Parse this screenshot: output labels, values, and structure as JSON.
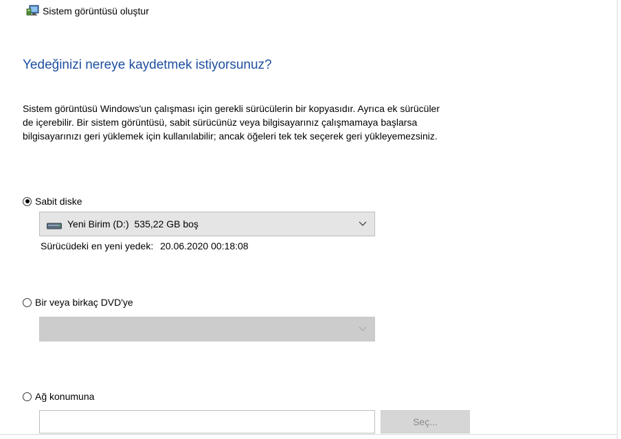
{
  "window": {
    "title": "Sistem görüntüsü oluştur"
  },
  "heading": "Yedeğinizi nereye kaydetmek istiyorsunuz?",
  "description": [
    "Sistem görüntüsü Windows'un çalışması için gerekli sürücülerin bir kopyasıdır. Ayrıca ek sürücüler",
    "de içerebilir. Bir sistem görüntüsü, sabit sürücünüz veya bilgisayarınız çalışmamaya başlarsa",
    "bilgisayarınızı geri yüklemek için kullanılabilir; ancak öğeleri tek tek seçerek geri yükleyemezsiniz."
  ],
  "options": {
    "hard_disk": {
      "label": "Sabit diske",
      "selected": true,
      "drive_value": "Yeni Birim (D:)  535,22 GB boş",
      "drive_icon": "drive-icon",
      "last_backup_label": "Sürücüdeki en yeni yedek:",
      "last_backup_value": "20.06.2020 00:18:08"
    },
    "dvd": {
      "label": "Bir veya birkaç DVD'ye",
      "selected": false,
      "drive_value": ""
    },
    "network": {
      "label": "Ağ konumuna",
      "selected": false,
      "path_value": "",
      "browse_label": "Seç..."
    }
  },
  "colors": {
    "heading": "#1e4fa0",
    "combo_bg": "#e5e5e5",
    "combo_disabled_bg": "#cccccc",
    "button_disabled_text": "#8a8a8a"
  }
}
